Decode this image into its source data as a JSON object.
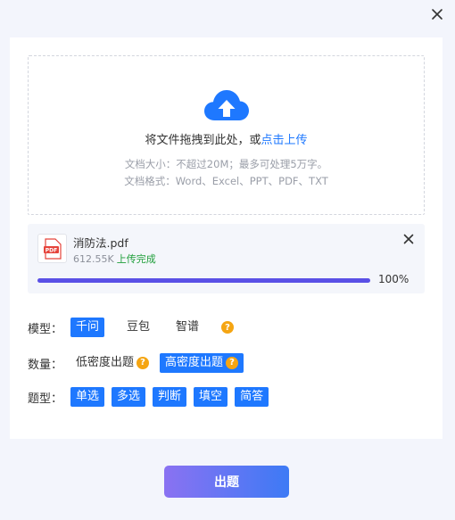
{
  "upload": {
    "prompt": "将文件拖拽到此处，或",
    "link": "点击上传",
    "hint_size": "文档大小：不超过20M；最多可处理5万字。",
    "hint_format": "文档格式：Word、Excel、PPT、PDF、TXT"
  },
  "file": {
    "icon_text": "PDF",
    "name": "消防法.pdf",
    "size": "612.55K",
    "status": "上传完成",
    "progress": 100,
    "progress_text": "100%"
  },
  "model": {
    "label": "模型：",
    "options": [
      "千问",
      "豆包",
      "智谱"
    ],
    "selected": "千问"
  },
  "quantity": {
    "label": "数量：",
    "options": [
      "低密度出题",
      "高密度出题"
    ],
    "selected": "高密度出题"
  },
  "question_type": {
    "label": "题型：",
    "options": [
      "单选",
      "多选",
      "判断",
      "填空",
      "简答"
    ]
  },
  "submit_label": "出题",
  "help_glyph": "?",
  "colors": {
    "accent": "#1e78ff",
    "progress": "#5a50e6",
    "success": "#1e9e3a",
    "help": "#f5a512",
    "pdf_red": "#e5433b"
  }
}
